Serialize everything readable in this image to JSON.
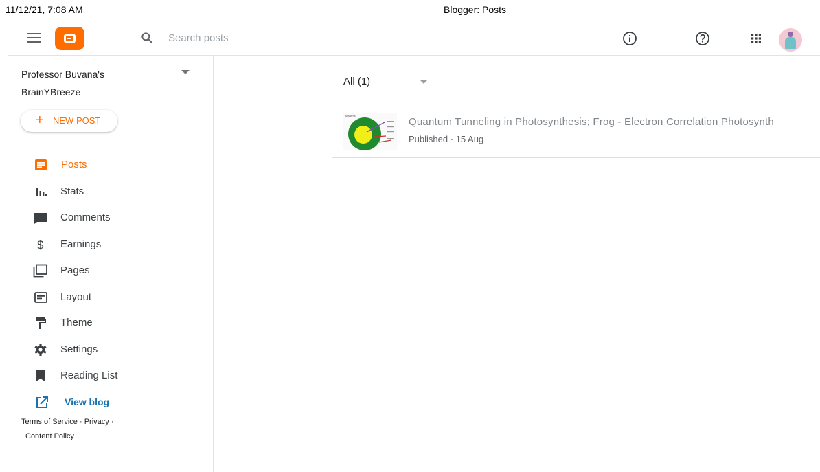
{
  "print_header": {
    "datetime": "11/12/21, 7:08 AM",
    "page_title": "Blogger: Posts"
  },
  "topbar": {
    "search_placeholder": "Search posts",
    "icons": [
      "menu-icon",
      "blogger-logo",
      "search-icon",
      "info-icon",
      "help-icon",
      "apps-grid-icon",
      "avatar"
    ]
  },
  "sidebar": {
    "blog_name_line1": "Professor Buvana's",
    "blog_name_line2": "BrainYBreeze",
    "new_post_label": "NEW POST",
    "items": [
      {
        "label": "Posts",
        "icon": "posts-icon",
        "active": true
      },
      {
        "label": "Stats",
        "icon": "stats-icon"
      },
      {
        "label": "Comments",
        "icon": "comments-icon"
      },
      {
        "label": "Earnings",
        "icon": "dollar-icon"
      },
      {
        "label": "Pages",
        "icon": "pages-icon"
      },
      {
        "label": "Layout",
        "icon": "layout-icon"
      },
      {
        "label": "Theme",
        "icon": "paint-roller-icon"
      },
      {
        "label": "Settings",
        "icon": "gear-icon"
      },
      {
        "label": "Reading List",
        "icon": "bookmark-icon"
      },
      {
        "label": "View blog",
        "icon": "open-external-icon"
      }
    ],
    "footer": {
      "terms": "Terms of Service",
      "sep1": "·",
      "privacy": "Privacy",
      "sep2": "·",
      "content_policy": "Content Policy"
    }
  },
  "main": {
    "filter_label": "All (1)",
    "posts": [
      {
        "title": "Quantum Tunneling in Photosynthesis; Frog - Electron Correlation Photosynth",
        "status": "Published",
        "separator": "·",
        "date": "15 Aug",
        "thumbnail_label": "systems"
      }
    ]
  },
  "colors": {
    "accent": "#ff6d00",
    "link": "#1a73b0",
    "muted": "#80868b"
  }
}
